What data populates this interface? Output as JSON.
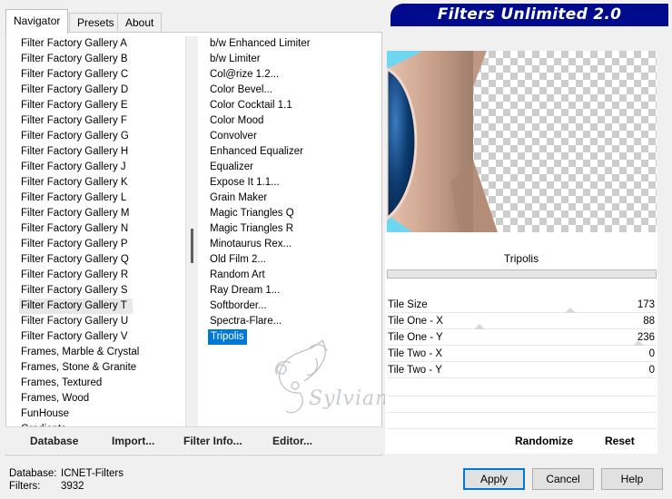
{
  "tabs": [
    "Navigator",
    "Presets",
    "About"
  ],
  "active_tab": "Navigator",
  "banner_title": "Filters Unlimited 2.0",
  "categories": [
    "Filter Factory Gallery A",
    "Filter Factory Gallery B",
    "Filter Factory Gallery C",
    "Filter Factory Gallery D",
    "Filter Factory Gallery E",
    "Filter Factory Gallery F",
    "Filter Factory Gallery G",
    "Filter Factory Gallery H",
    "Filter Factory Gallery J",
    "Filter Factory Gallery K",
    "Filter Factory Gallery L",
    "Filter Factory Gallery M",
    "Filter Factory Gallery N",
    "Filter Factory Gallery P",
    "Filter Factory Gallery Q",
    "Filter Factory Gallery R",
    "Filter Factory Gallery S",
    "Filter Factory Gallery T",
    "Filter Factory Gallery U",
    "Filter Factory Gallery V",
    "Frames, Marble & Crystal",
    "Frames, Stone & Granite",
    "Frames, Textured",
    "Frames, Wood",
    "FunHouse",
    "Gradients"
  ],
  "selected_category": "Filter Factory Gallery T",
  "filters": [
    "b/w Enhanced Limiter",
    "b/w Limiter",
    "Col@rize 1.2...",
    "Color Bevel...",
    "Color Cocktail 1.1",
    "Color Mood",
    "Convolver",
    "Enhanced Equalizer",
    "Equalizer",
    "Expose It 1.1...",
    "Grain Maker",
    "Magic Triangles Q",
    "Magic Triangles R",
    "Minotaurus Rex...",
    "Old Film 2...",
    "Random Art",
    "Ray Dream 1...",
    "Softborder...",
    "Spectra-Flare...",
    "Tripolis"
  ],
  "selected_filter": "Tripolis",
  "left_buttons": {
    "database": "Database",
    "import": "Import...",
    "filter_info": "Filter Info...",
    "editor": "Editor..."
  },
  "filter_name": "Tripolis",
  "params": [
    {
      "label": "Tile Size",
      "value": "173"
    },
    {
      "label": "Tile One - X",
      "value": "88"
    },
    {
      "label": "Tile One - Y",
      "value": "236"
    },
    {
      "label": "Tile Two - X",
      "value": "0"
    },
    {
      "label": "Tile Two - Y",
      "value": "0"
    }
  ],
  "right_buttons": {
    "randomize": "Randomize",
    "reset": "Reset"
  },
  "footer": {
    "database_label": "Database:",
    "database_value": "ICNET-Filters",
    "filters_label": "Filters:",
    "filters_value": "3932"
  },
  "dialog_buttons": {
    "apply": "Apply",
    "cancel": "Cancel",
    "help": "Help"
  },
  "watermark_text": "Sylviane",
  "colors": {
    "banner_bg": "#000a8c",
    "selection": "#0078d7",
    "preview_blue": "#0d3c70",
    "preview_tan": "#c8a08c"
  }
}
